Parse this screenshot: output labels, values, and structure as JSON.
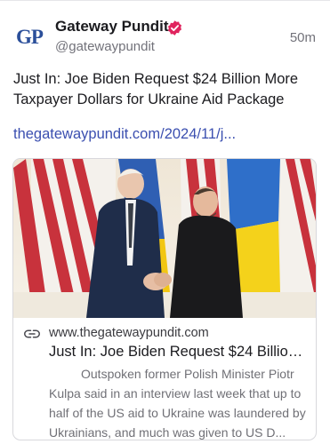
{
  "author": {
    "avatar_text": "GP",
    "name": "Gateway Pundit",
    "handle": "@gatewaypundit",
    "verified_icon": "verified-badge-icon",
    "verified_color": "#e0245e"
  },
  "post": {
    "time": "50m",
    "text": "Just In: Joe Biden Request $24 Billion More Taxpayer Dollars for Ukraine Aid Package",
    "link_text": "thegatewaypundit.com/2024/11/j...",
    "link_color": "#3b4fb0"
  },
  "card": {
    "link_icon": "link-icon",
    "domain": "www.thegatewaypundit.com",
    "title": "Just In: Joe Biden Request $24 Billion ...",
    "description": "Outspoken former Polish Minister Piotr Kulpa said in an interview last week that up to half of the US aid to Ukraine was laundered by Ukrainians, and much was given to US D..."
  }
}
